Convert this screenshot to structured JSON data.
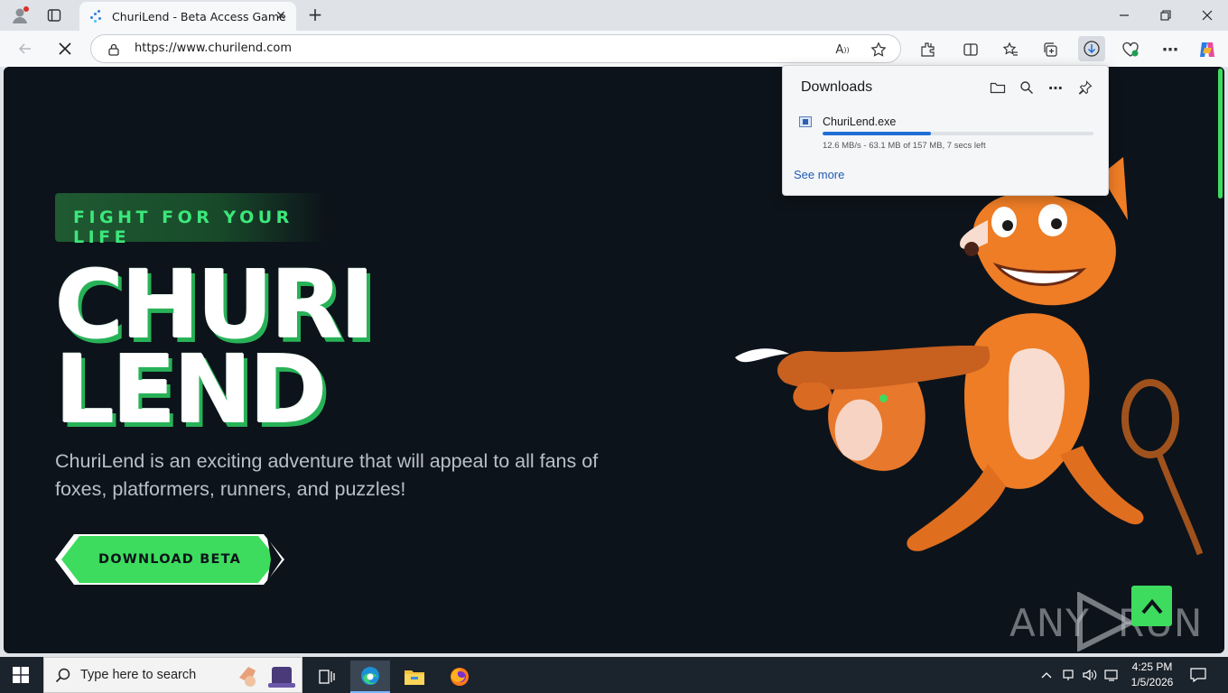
{
  "browser": {
    "tab_title": "ChuriLend - Beta Access Game",
    "url": "https://www.churilend.com"
  },
  "page": {
    "badge": "FIGHT FOR YOUR LIFE",
    "title_line1": "CHURI",
    "title_line2": "LEND",
    "description": "ChuriLend is an exciting adventure that will appeal to all fans of foxes, platformers, runners, and puzzles!",
    "cta_label": "DOWNLOAD BETA",
    "watermark_left": "ANY",
    "watermark_right": "RUN"
  },
  "downloads": {
    "title": "Downloads",
    "file_name": "ChuriLend.exe",
    "progress_fraction": 0.4,
    "status": "12.6 MB/s - 63.1 MB of 157 MB, 7 secs left",
    "see_more": "See more"
  },
  "taskbar": {
    "search_placeholder": "Type here to search",
    "time": "4:25 PM",
    "date": "1/5/2026"
  },
  "colors": {
    "accent_green": "#3ddc5e",
    "page_bg": "#0d131a",
    "progress_blue": "#1f6fd6"
  }
}
